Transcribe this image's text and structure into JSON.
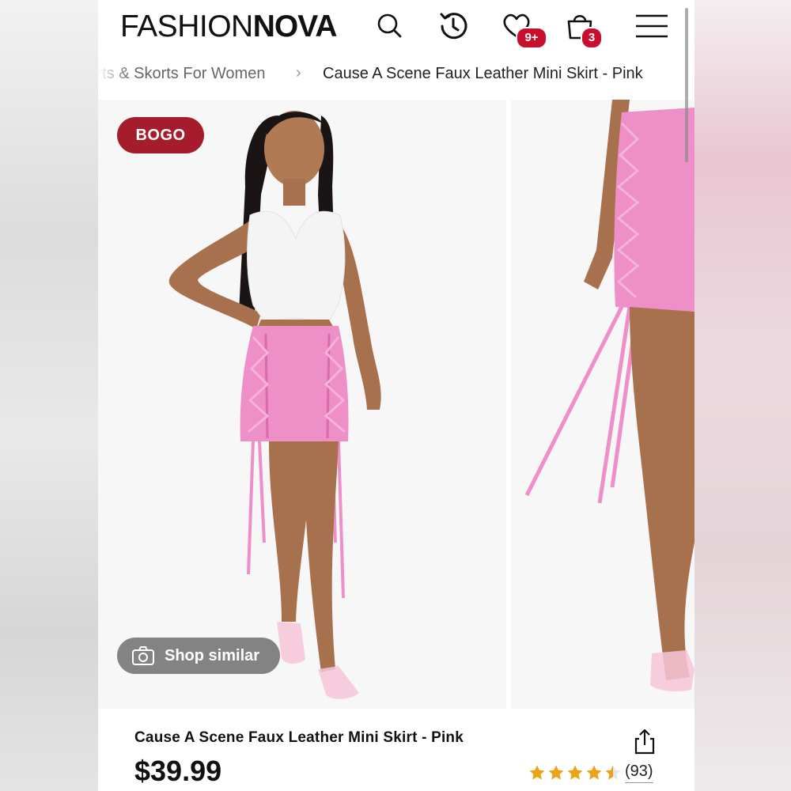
{
  "header": {
    "logo_part1": "FASHION",
    "logo_part2": "NOVA",
    "wishlist_badge": "9+",
    "cart_badge": "3"
  },
  "breadcrumb": {
    "parent": "irts & Skorts For Women",
    "separator": "›",
    "current": "Cause A Scene Faux Leather Mini Skirt - Pink"
  },
  "gallery": {
    "bogo_label": "BOGO",
    "shop_similar_label": "Shop similar"
  },
  "product": {
    "title": "Cause A Scene Faux Leather Mini Skirt - Pink",
    "price": "$39.99",
    "rating": 4.5,
    "reviews_count": "(93)"
  },
  "colors": {
    "badge_red": "#c8102e",
    "bogo_red": "#a51d2d",
    "star_gold": "#e8a317",
    "skirt_pink": "#ee8fc8"
  }
}
